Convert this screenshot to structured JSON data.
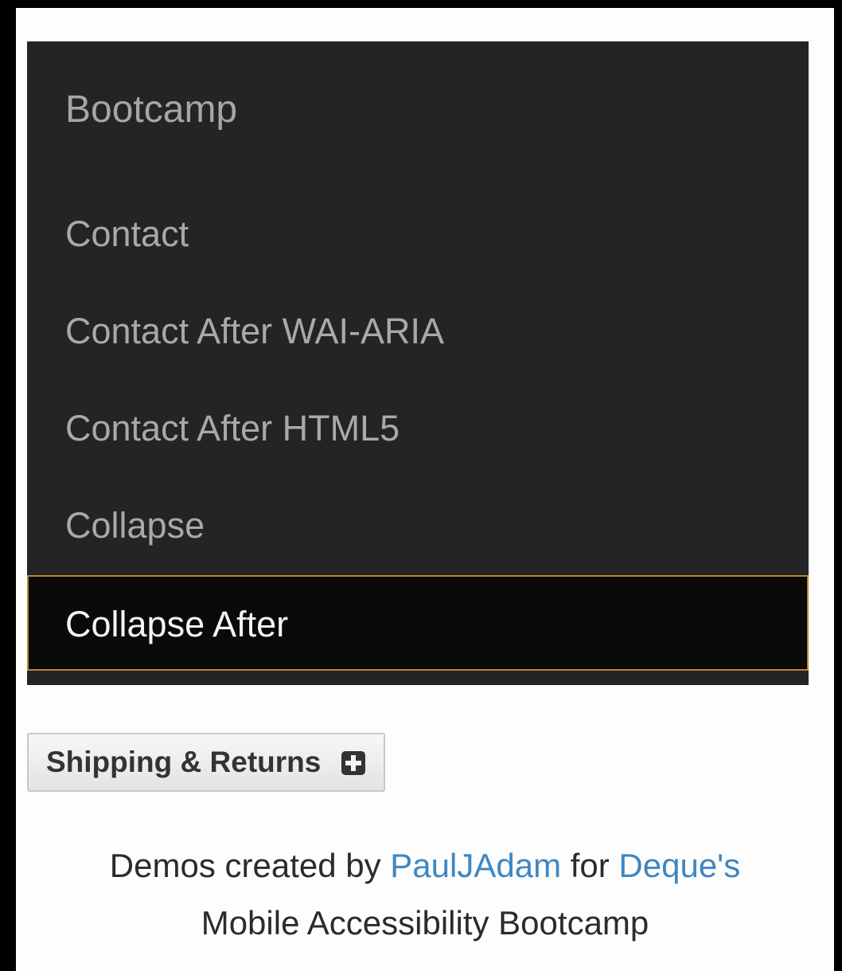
{
  "nav": {
    "brand": "Bootcamp",
    "items": [
      {
        "label": "Contact"
      },
      {
        "label": "Contact After WAI-ARIA"
      },
      {
        "label": "Contact After HTML5"
      },
      {
        "label": "Collapse"
      },
      {
        "label": "Collapse After",
        "active": true
      }
    ]
  },
  "accordion": {
    "label": "Shipping & Returns",
    "icon": "plus-square-icon"
  },
  "footer": {
    "prefix": "Demos created by",
    "author_link": "PaulJAdam",
    "middle": "for",
    "org_link": "Deque's",
    "line2": "Mobile Accessibility Bootcamp"
  },
  "colors": {
    "nav_background": "#242426",
    "active_background": "#0a0a0a",
    "focus_outline": "#b9862f",
    "link": "#3d87c3"
  }
}
